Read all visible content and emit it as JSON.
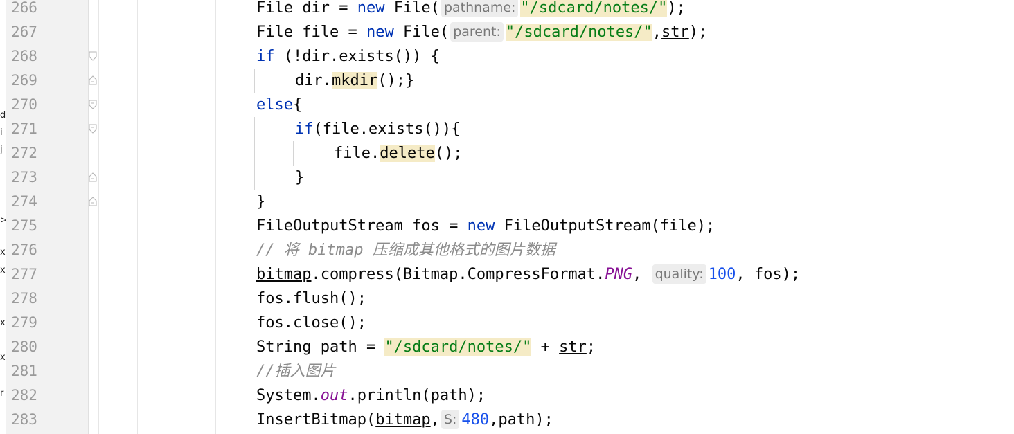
{
  "left_panel_fragments": [
    "d",
    "i",
    "j",
    ">",
    "x",
    "x",
    "x",
    "x",
    "r"
  ],
  "gutter": {
    "line_numbers": [
      "266",
      "267",
      "268",
      "269",
      "270",
      "271",
      "272",
      "273",
      "274",
      "275",
      "276",
      "277",
      "278",
      "279",
      "280",
      "281",
      "282",
      "283"
    ]
  },
  "code": {
    "l266": {
      "a": "File dir = ",
      "kw": "new",
      "b": " File(",
      "hint": "pathname:",
      "str": "\"/sdcard/notes/\"",
      "c": ");"
    },
    "l267": {
      "a": "File file = ",
      "kw": "new",
      "b": " File(",
      "hint": "parent:",
      "str": "\"/sdcard/notes/\"",
      "c": ",",
      "var": "str",
      "d": ");"
    },
    "l268": {
      "kw": "if",
      "a": " (!dir.exists()) {"
    },
    "l269": {
      "a": "dir.",
      "m": "mkdir",
      "b": "();}"
    },
    "l270": {
      "kw": "else",
      "a": "{"
    },
    "l271": {
      "kw": "if",
      "a": "(file.exists()){"
    },
    "l272": {
      "a": "file.",
      "m": "delete",
      "b": "();"
    },
    "l273": {
      "a": "}"
    },
    "l274": {
      "a": "}"
    },
    "l275": {
      "a": "FileOutputStream fos = ",
      "kw": "new",
      "b": " FileOutputStream(file);"
    },
    "l276": {
      "cmt": "// 将 bitmap 压缩成其他格式的图片数据"
    },
    "l277": {
      "var": "bitmap",
      "a": ".compress(Bitmap.CompressFormat.",
      "field": "PNG",
      "b": ", ",
      "hint": "quality:",
      "num": "100",
      "c": ", fos);"
    },
    "l278": {
      "a": "fos.flush();"
    },
    "l279": {
      "a": "fos.close();"
    },
    "l280": {
      "a": "String path = ",
      "str": "\"/sdcard/notes/\"",
      "b": " + ",
      "var": "str",
      "c": ";"
    },
    "l281": {
      "cmt": "//插入图片"
    },
    "l282": {
      "a": "System.",
      "field": "out",
      "b": ".println(path);"
    },
    "l283": {
      "a": "InsertBitmap(",
      "var": "bitmap",
      "b": ",",
      "hint": "S:",
      "num": "480",
      "c": ",path);"
    }
  },
  "colors": {
    "keyword": "#0033b3",
    "string": "#067d17",
    "number": "#1750eb",
    "comment": "#8c8c8c",
    "field": "#871094",
    "highlight": "#f5ebc6"
  }
}
